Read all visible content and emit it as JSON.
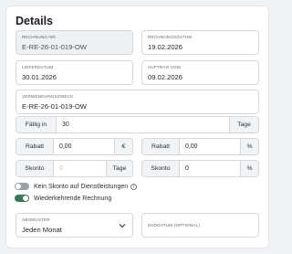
{
  "details": {
    "title": "Details"
  },
  "invoice_number": {
    "label": "RECHNUNG-NR.",
    "value": "E-RE-26-01-019-OW"
  },
  "invoice_date": {
    "label": "RECHNUNGSDATUM",
    "value": "19.02.2026"
  },
  "delivery_date": {
    "label": "LIEFERDATUM",
    "value": "30.01.2026"
  },
  "order_date": {
    "label": "AUFTRAG VOM",
    "value": "09.02.2026"
  },
  "purpose": {
    "label": "VERWENDUNGSZWECK",
    "value": "E-RE-26-01-019-OW"
  },
  "due": {
    "label": "Fällig in",
    "value": "30",
    "unit": "Tage"
  },
  "discount_left": {
    "label": "Rabatt",
    "value": "0,00",
    "unit": "€"
  },
  "discount_right": {
    "label": "Rabatt",
    "value": "0,00",
    "unit": "%"
  },
  "skonto_left": {
    "label": "Skonto",
    "placeholder": "0",
    "unit": "Tage"
  },
  "skonto_right": {
    "label": "Skonto",
    "value": "0",
    "unit": "%"
  },
  "toggle_no_skonto": {
    "label": "Kein Skonto auf Dienstleistungen",
    "state": "off",
    "icon": "info-icon"
  },
  "toggle_recurring": {
    "label": "Wiederkehrende Rechnung",
    "state": "on"
  },
  "pattern": {
    "label": "ABOMUSTER",
    "value": "Jeden Monat"
  },
  "end_date": {
    "label": "ENDDATUM (OPTIONAL)",
    "value": ""
  },
  "colors": {
    "toggle_on": "#35795a",
    "toggle_off": "#9aa0a8",
    "border": "#d4d8dd",
    "addon_bg": "#f2f3f5"
  }
}
